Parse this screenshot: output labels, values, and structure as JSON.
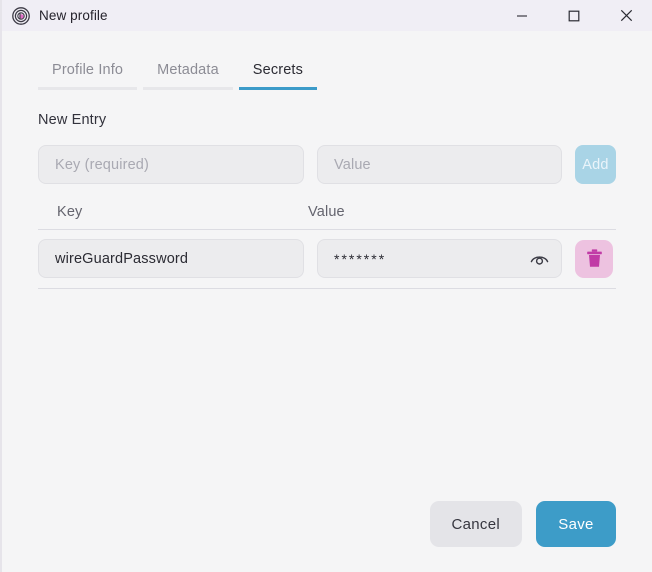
{
  "window": {
    "title": "New profile",
    "icon": "app-logo-icon",
    "controls": {
      "minimize": "minimize-icon",
      "maximize": "maximize-icon",
      "close": "close-icon"
    },
    "colors": {
      "titlebar_bg": "#f0eef5",
      "body_bg": "#f5f5f6",
      "accent_blue": "#3d9cc8",
      "accent_blue_disabled": "#a9d4e6",
      "delete_pink_bg": "#edc2e0",
      "delete_pink_icon": "#c13ba6",
      "field_bg": "#ececee",
      "field_border": "#e0e0e4"
    }
  },
  "tabs": [
    {
      "label": "Profile Info",
      "active": false
    },
    {
      "label": "Metadata",
      "active": false
    },
    {
      "label": "Secrets",
      "active": true
    }
  ],
  "new_entry": {
    "title": "New Entry",
    "key_placeholder": "Key (required)",
    "key_value": "",
    "value_placeholder": "Value",
    "value_value": "",
    "add_label": "Add"
  },
  "table": {
    "columns": [
      "Key",
      "Value"
    ],
    "rows": [
      {
        "key": "wireGuardPassword",
        "value_masked": "*******",
        "reveal_icon": "eye-icon",
        "delete_icon": "trash-icon"
      }
    ]
  },
  "footer": {
    "cancel_label": "Cancel",
    "save_label": "Save"
  }
}
